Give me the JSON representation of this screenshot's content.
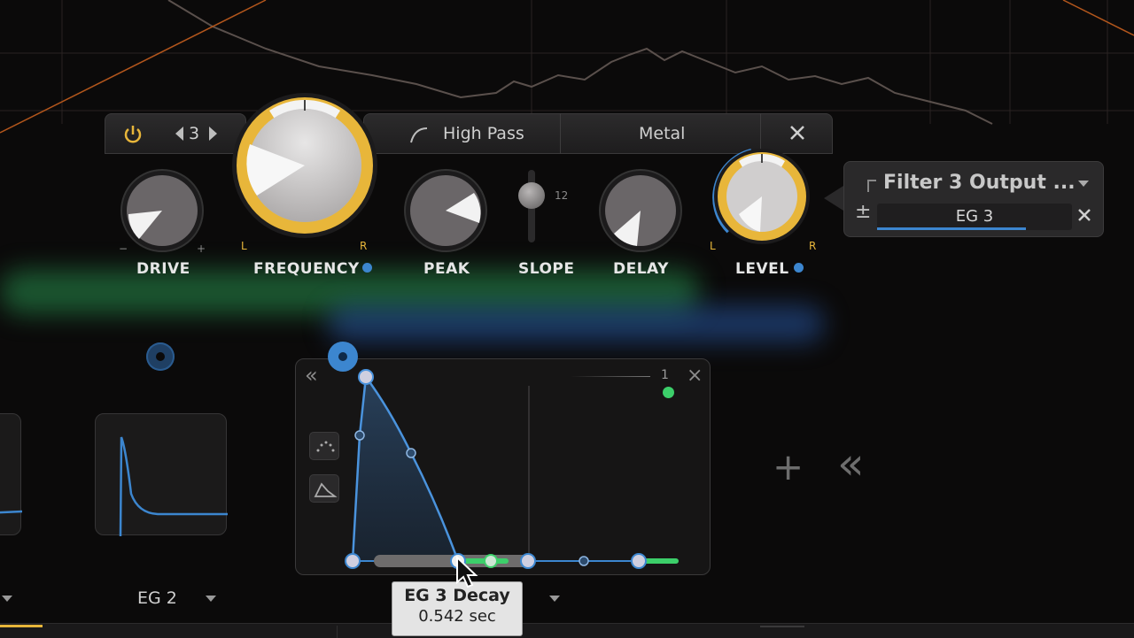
{
  "filter": {
    "band_number": "3",
    "filter_type": "High Pass",
    "style": "Metal",
    "knobs": {
      "drive": {
        "label": "DRIVE",
        "min_mark": "−",
        "max_mark": "+"
      },
      "frequency": {
        "label": "FREQUENCY",
        "left_mark": "L",
        "right_mark": "R"
      },
      "peak": {
        "label": "PEAK"
      },
      "slope": {
        "label": "SLOPE",
        "value": "12"
      },
      "delay": {
        "label": "DELAY"
      },
      "level": {
        "label": "LEVEL",
        "left_mark": "L",
        "right_mark": "R"
      }
    }
  },
  "modulation_popup": {
    "target": "Filter 3 Output ...",
    "plus_minus": "±",
    "source": "EG 3"
  },
  "eg_editor": {
    "marker_value": "1",
    "collapse_glyph": "«",
    "close_glyph": "×"
  },
  "eg_slots": {
    "eg2_label": "EG 2",
    "add_glyph": "+",
    "collapse_glyph": "«"
  },
  "tooltip": {
    "title": "EG 3 Decay",
    "value": "0.542 sec"
  },
  "colors": {
    "accent_gold": "#e8b63a",
    "mod_blue": "#3c86cf",
    "green": "#3ccf6a"
  }
}
